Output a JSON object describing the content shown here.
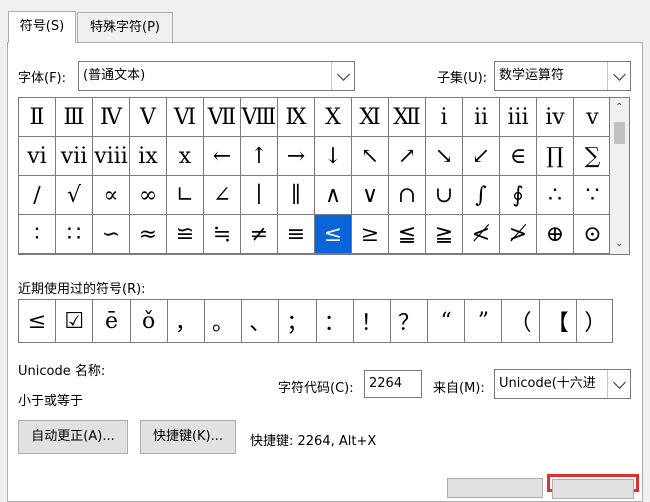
{
  "tabs": [
    {
      "label": "符号(S)"
    },
    {
      "label": "特殊字符(P)"
    }
  ],
  "font": {
    "label": "字体(F):",
    "value": "(普通文本)"
  },
  "subset": {
    "label": "子集(U):",
    "value": "数学运算符"
  },
  "symbol_grid": [
    [
      "Ⅱ",
      "Ⅲ",
      "Ⅳ",
      "Ⅴ",
      "Ⅵ",
      "Ⅶ",
      "Ⅷ",
      "Ⅸ",
      "Ⅹ",
      "Ⅺ",
      "Ⅻ",
      "ⅰ",
      "ⅱ",
      "ⅲ",
      "ⅳ",
      "ⅴ"
    ],
    [
      "ⅵ",
      "ⅶ",
      "ⅷ",
      "ⅸ",
      "ⅹ",
      "←",
      "↑",
      "→",
      "↓",
      "↖",
      "↗",
      "↘",
      "↙",
      "∈",
      "∏",
      "∑"
    ],
    [
      "∕",
      "√",
      "∝",
      "∞",
      "∟",
      "∠",
      "∣",
      "∥",
      "∧",
      "∨",
      "∩",
      "∪",
      "∫",
      "∮",
      "∴",
      "∵"
    ],
    [
      "∶",
      "∷",
      "∽",
      "≈",
      "≌",
      "≒",
      "≠",
      "≡",
      "≤",
      "≥",
      "≦",
      "≧",
      "≮",
      "≯",
      "⊕",
      "⊙"
    ]
  ],
  "selected_symbol": "≤",
  "recent": {
    "label": "近期使用过的符号(R):",
    "symbols": [
      "≤",
      "☑",
      "ē",
      "ǒ",
      "，",
      "。",
      "、",
      "；",
      "：",
      "！",
      "？",
      "“",
      "”",
      "（",
      "【",
      "）"
    ]
  },
  "unicode_name": {
    "label": "Unicode 名称:",
    "value": "小于或等于"
  },
  "char_code": {
    "label": "字符代码(C):",
    "value": "2264"
  },
  "from": {
    "label": "来自(M):",
    "value": "Unicode(十六进"
  },
  "buttons": {
    "autocorrect": "自动更正(A)...",
    "shortcut": "快捷键(K)...",
    "shortcut_info": "快捷键: 2264, Alt+X"
  },
  "colors": {
    "selection": "#0a66d8",
    "highlight_border": "#e03030"
  }
}
